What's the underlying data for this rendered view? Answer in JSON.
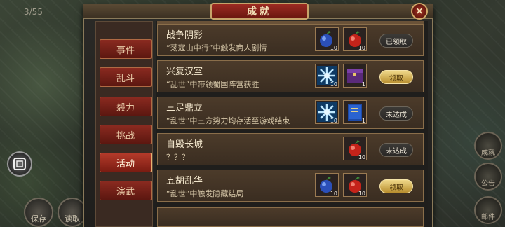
{
  "hud": {
    "page_counter": "3/55",
    "left_bottom_buttons": [
      "保存",
      "读取"
    ],
    "right_buttons": [
      "成就",
      "公告",
      "邮件"
    ]
  },
  "panel": {
    "title": "成就",
    "close": "×"
  },
  "tabs": [
    {
      "label": "事件",
      "active": false
    },
    {
      "label": "乱斗",
      "active": false
    },
    {
      "label": "毅力",
      "active": false
    },
    {
      "label": "挑战",
      "active": false
    },
    {
      "label": "活动",
      "active": true
    },
    {
      "label": "演武",
      "active": false
    }
  ],
  "achievements": [
    {
      "title": "战争阴影",
      "desc": "“荡寇山中行”中触发商人剧情",
      "rewards": [
        {
          "icon": "blue-fruit-icon",
          "count": "10"
        },
        {
          "icon": "red-fruit-icon",
          "count": "10"
        }
      ],
      "status": "已领取"
    },
    {
      "title": "兴复汉室",
      "desc": "“乱世”中带领蜀国阵营获胜",
      "rewards": [
        {
          "icon": "ice-crystal-icon",
          "count": "10"
        },
        {
          "icon": "purple-chest-icon",
          "count": "1"
        }
      ],
      "status": "领取"
    },
    {
      "title": "三足鼎立",
      "desc": "“乱世”中三方势力均存活至游戏结束",
      "rewards": [
        {
          "icon": "ice-crystal-icon",
          "count": "10"
        },
        {
          "icon": "blue-book-icon",
          "count": "1"
        }
      ],
      "status": "未达成"
    },
    {
      "title": "自毁长城",
      "desc": "？？？",
      "rewards": [
        {
          "icon": "red-fruit-icon",
          "count": "10"
        }
      ],
      "status": "未达成"
    },
    {
      "title": "五胡乱华",
      "desc": "“乱世”中触发隐藏结局",
      "rewards": [
        {
          "icon": "blue-fruit-icon",
          "count": "10"
        },
        {
          "icon": "red-fruit-icon",
          "count": "10"
        }
      ],
      "status": "领取"
    }
  ],
  "colors": {
    "tab_red": "#8a2a20",
    "claim_gold": "#f0d98a",
    "frame_gold": "#8a6e4a"
  }
}
